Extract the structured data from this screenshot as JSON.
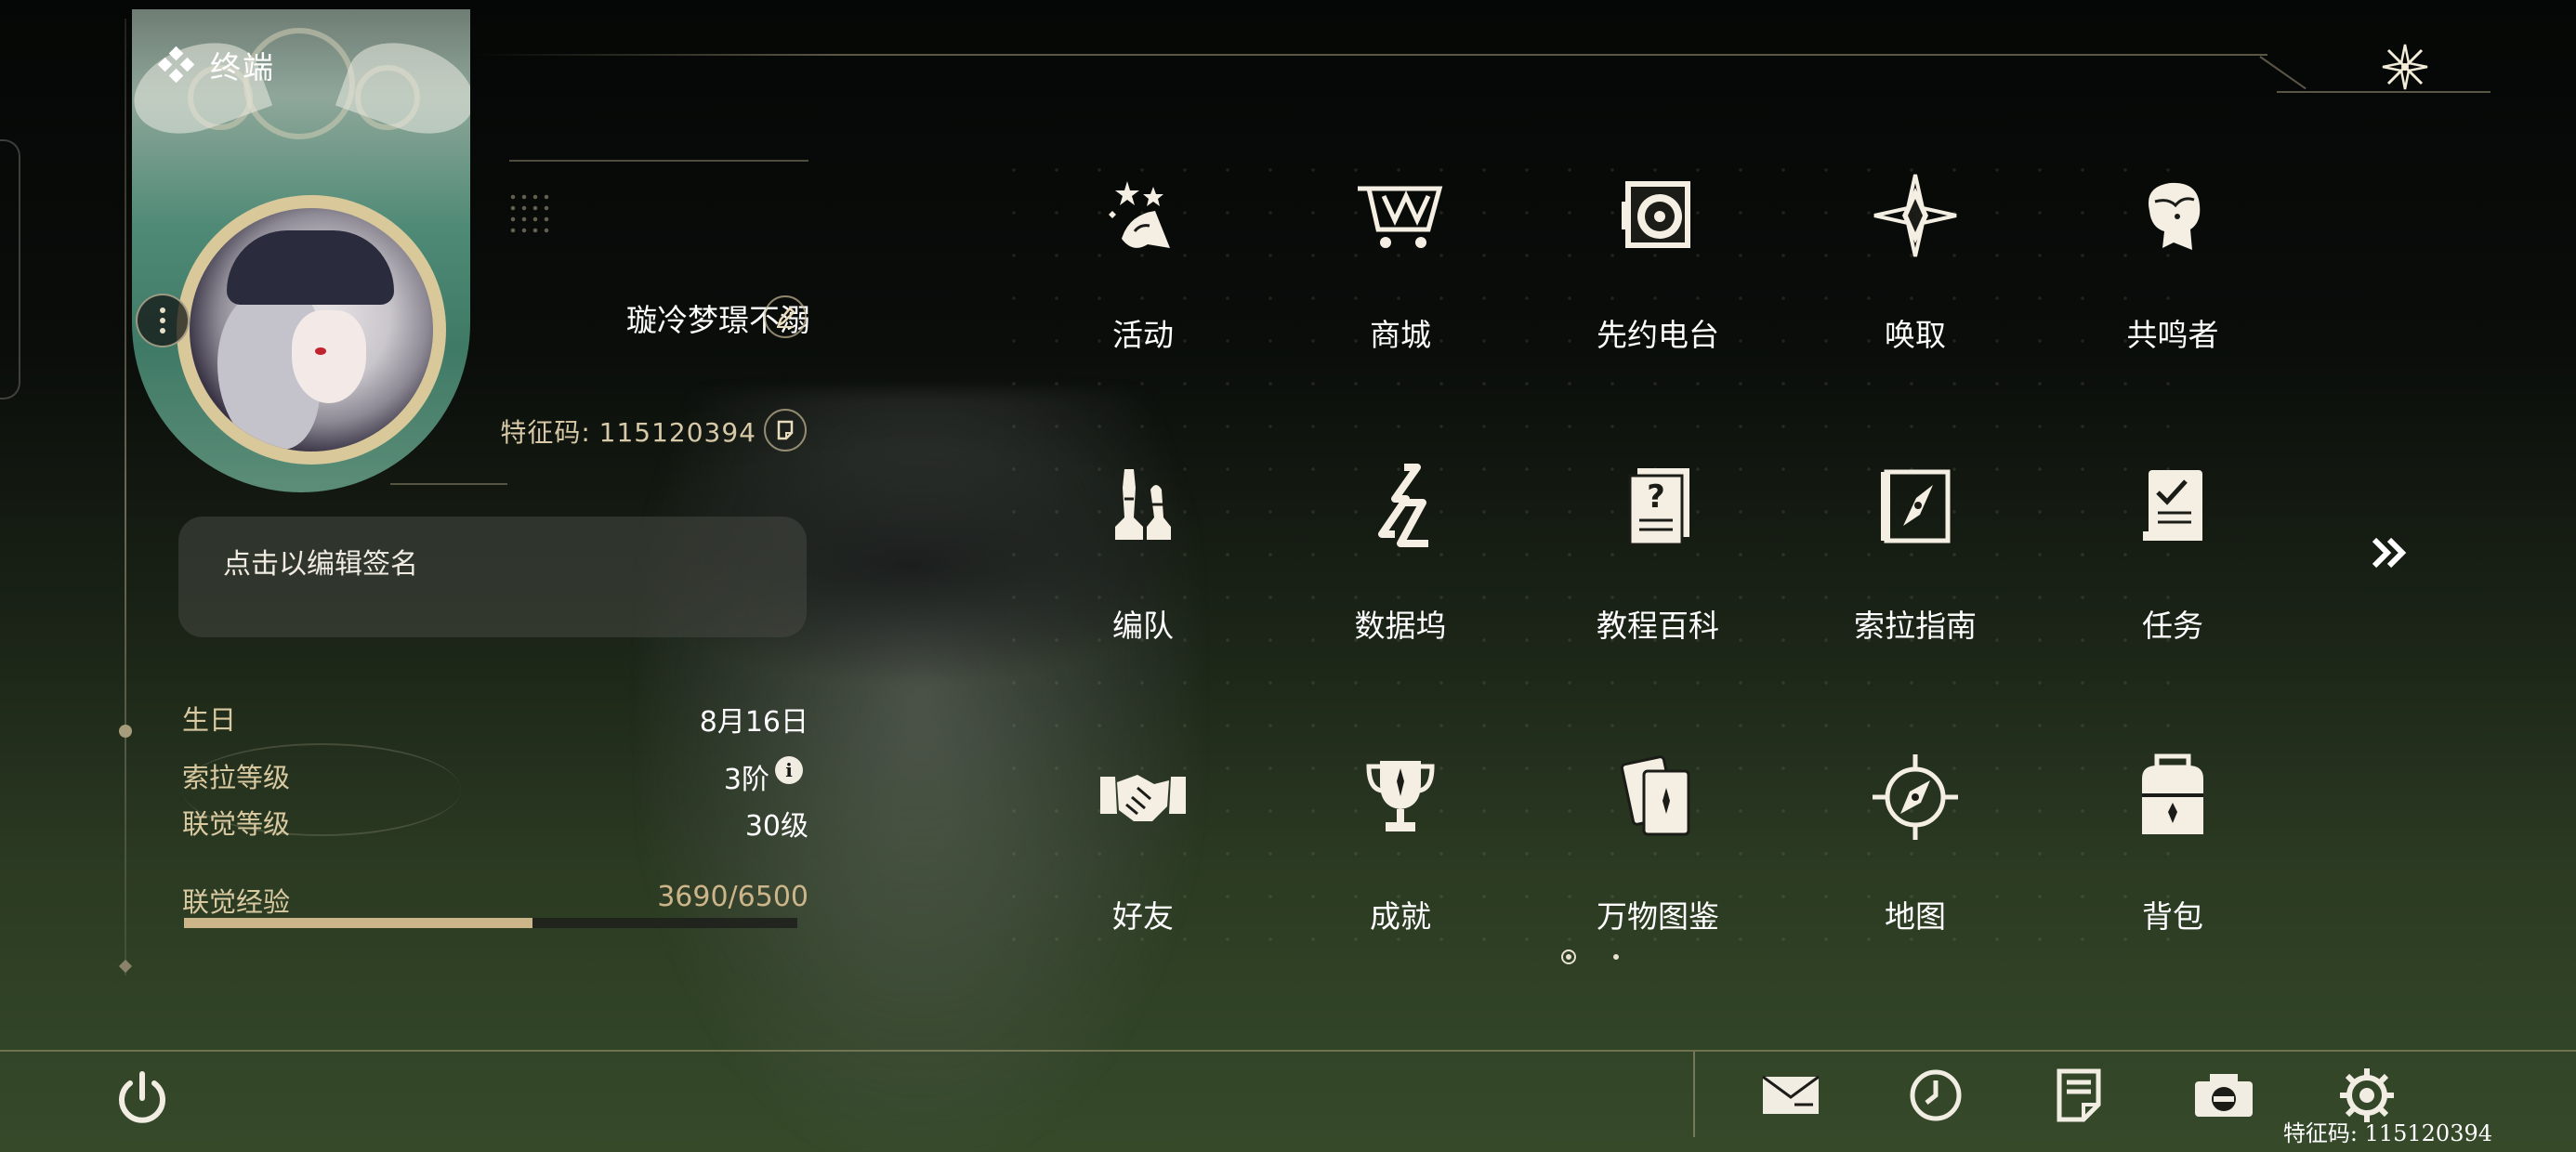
{
  "header": {
    "title": "终端",
    "title_icon": "diamond-cluster-icon",
    "close_icon": "four-point-star-close-icon"
  },
  "profile": {
    "username": "璇冷梦璟不溺",
    "uid_label": "特征码:",
    "uid_value": "115120394",
    "signature_placeholder": "点击以编辑签名",
    "stats": [
      {
        "label": "生日",
        "value": "8月16日"
      },
      {
        "label": "索拉等级",
        "value": "3阶"
      },
      {
        "label": "联觉等级",
        "value": "30级"
      }
    ],
    "exp": {
      "label": "联觉经验",
      "value": "3690/6500",
      "current": 3690,
      "max": 6500
    }
  },
  "menu": {
    "items": [
      {
        "label": "活动",
        "icon": "event-stars-icon"
      },
      {
        "label": "商城",
        "icon": "shop-cart-icon"
      },
      {
        "label": "先约电台",
        "icon": "radio-record-icon"
      },
      {
        "label": "唤取",
        "icon": "compass-star-icon"
      },
      {
        "label": "共鸣者",
        "icon": "resonator-head-icon"
      },
      {
        "label": "编队",
        "icon": "chess-pieces-icon"
      },
      {
        "label": "数据坞",
        "icon": "data-dock-icon"
      },
      {
        "label": "教程百科",
        "icon": "tutorial-book-icon"
      },
      {
        "label": "索拉指南",
        "icon": "guidebook-compass-icon"
      },
      {
        "label": "任务",
        "icon": "quest-check-icon"
      },
      {
        "label": "好友",
        "icon": "handshake-icon"
      },
      {
        "label": "成就",
        "icon": "trophy-icon"
      },
      {
        "label": "万物图鉴",
        "icon": "cards-codex-icon"
      },
      {
        "label": "地图",
        "icon": "map-compass-icon"
      },
      {
        "label": "背包",
        "icon": "backpack-icon"
      }
    ],
    "page_current": 1,
    "page_total": 2
  },
  "bottom_bar": {
    "icons": [
      "mail-icon",
      "clock-icon",
      "notice-icon",
      "camera-icon",
      "settings-icon"
    ],
    "footer_uid": "特征码: 115120394"
  },
  "colors": {
    "accent_gold": "#cdb58a",
    "text_white": "#ffffff",
    "label_gold": "#d9c9a1"
  }
}
